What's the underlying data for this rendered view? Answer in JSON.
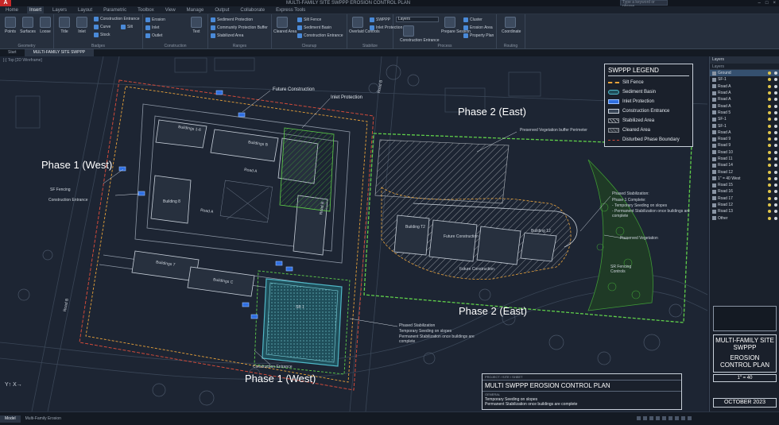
{
  "app": {
    "logo": "A",
    "title": "MULTI-FAMILY SITE SWPPP EROSION CONTROL PLAN",
    "search_placeholder": "Type a keyword or phrase",
    "window_controls": [
      "–",
      "□",
      "×"
    ]
  },
  "ribbon_tabs": [
    "Home",
    "Insert",
    "Layers",
    "Layout",
    "Parametric",
    "Toolbox",
    "View",
    "Manage",
    "Output",
    "Collaborate",
    "Express Tools"
  ],
  "ribbon": {
    "panels": [
      {
        "title": "Geometry",
        "tools": [
          "Points",
          "Surfaces",
          "Loose"
        ]
      },
      {
        "title": "Badges",
        "tools": [
          "Title",
          "Inlet",
          "Construction Entrance",
          "Curve",
          "Stock",
          "Silt"
        ]
      },
      {
        "title": "Construction",
        "tools": [
          "Erosion",
          "Inlet",
          "Outlet",
          "Text"
        ]
      },
      {
        "title": "Ranges",
        "tools": [
          "Sediment Protection",
          "Community Protection Buffer",
          "Stabilized Area"
        ]
      },
      {
        "title": "Cleanup",
        "tools": [
          "Cleared Area",
          "Silt Fence",
          "Sediment Basin",
          "Construction Entrance"
        ]
      },
      {
        "title": "Stabilize",
        "tools": [
          "Overlaid Controls",
          "SWPPP",
          "Inlet Protection"
        ]
      },
      {
        "title": "Process",
        "tools": [
          "Construction Entrance",
          "Prepare Session",
          "Cluster",
          "Erosion Area",
          "Property Plan"
        ]
      },
      {
        "title": "Routing",
        "tools": [
          "Coordinate"
        ]
      }
    ],
    "layer_dropdown": "Layers"
  },
  "doc_tabs": [
    "Start",
    "MULTI-FAMILY SITE SWPPP"
  ],
  "view_label": "[-] Top [2D Wireframe]",
  "drawing": {
    "phase_labels": [
      "Phase 1 (West)",
      "Phase 2 (East)",
      "Phase 2 (East)",
      "Phase 1 (West)"
    ],
    "road_labels": [
      "Road B",
      "Road B",
      "Road A",
      "Road B"
    ],
    "building_labels": [
      "Buildings 1-6",
      "Buildings B",
      "Building 8",
      "Buildings 7",
      "Buildings C",
      "Road A",
      "Future Construction",
      "Building T2",
      "Building 12"
    ],
    "notes": [
      "Future Construction",
      "Inlet Protection",
      "Preserved Vegetation buffer Perimeter",
      "SF Fencing",
      "Construction Entrance",
      "Phased Stabilization:",
      "Phase 1 Complete:",
      "- Temporary Seeding on slopes",
      "- Permanent Stabilization once buildings are complete",
      "Preserved Vegetation",
      "SR Fencing Controls",
      "Future Construction",
      "Phased Stabilization",
      "Temporary Seeding on slopes",
      "Permanent Stabilization once buildings are complete",
      "Construction Entrance",
      "SB 1"
    ]
  },
  "legend": {
    "title": "SWPPP LEGEND",
    "items": [
      {
        "label": "Silt Fence",
        "swatch": "dash-orange"
      },
      {
        "label": "Sediment Basin",
        "swatch": "basin"
      },
      {
        "label": "Inlet Protection",
        "swatch": "inlet"
      },
      {
        "label": "Construction Entrance",
        "swatch": "entrance"
      },
      {
        "label": "Stabilized Area",
        "swatch": "hatch"
      },
      {
        "label": "Cleared Area",
        "swatch": "hatch-dark"
      },
      {
        "label": "Disturbed Phase Boundary",
        "swatch": "dash-red"
      }
    ]
  },
  "layers_panel": {
    "title": "Layers",
    "column": "Layers",
    "rows": [
      "Ground",
      "SF-1",
      "Road A",
      "Road A",
      "Road A",
      "Road A",
      "Road 5",
      "SF-1",
      "SF-1",
      "Road A",
      "Road 9",
      "Road 9",
      "Road 10",
      "Road 11",
      "Road 14",
      "Road 12",
      "1\" = 40 West",
      "Road 15",
      "Road 16",
      "Road 17",
      "Road 12",
      "Road 13",
      "Other"
    ]
  },
  "title_block": {
    "project": "MULTI-FAMILY SITE SWPPP",
    "sheet": "EROSION CONTROL PLAN",
    "scale": "1\" = 40",
    "date": "OCTOBER 2023"
  },
  "plan_title_block": {
    "subheader": "PROJECT / SITE / SHEET",
    "title": "MULTI SWPPP EROSION CONTROL PLAN",
    "general": "GENERAL",
    "notes": [
      "Temporary Seeding on slopes",
      "Permanent Stabilization once buildings are complete"
    ]
  },
  "status": {
    "tabs": [
      "Model",
      "Multi-Family Erosion"
    ]
  },
  "colors": {
    "background": "#1d2533",
    "silt_fence": "#e8a23a",
    "phase_boundary": "#d04a3a",
    "stabilized": "#5fcf4a",
    "basin": "#4fb8c8",
    "inlet": "#2f6fe0"
  }
}
